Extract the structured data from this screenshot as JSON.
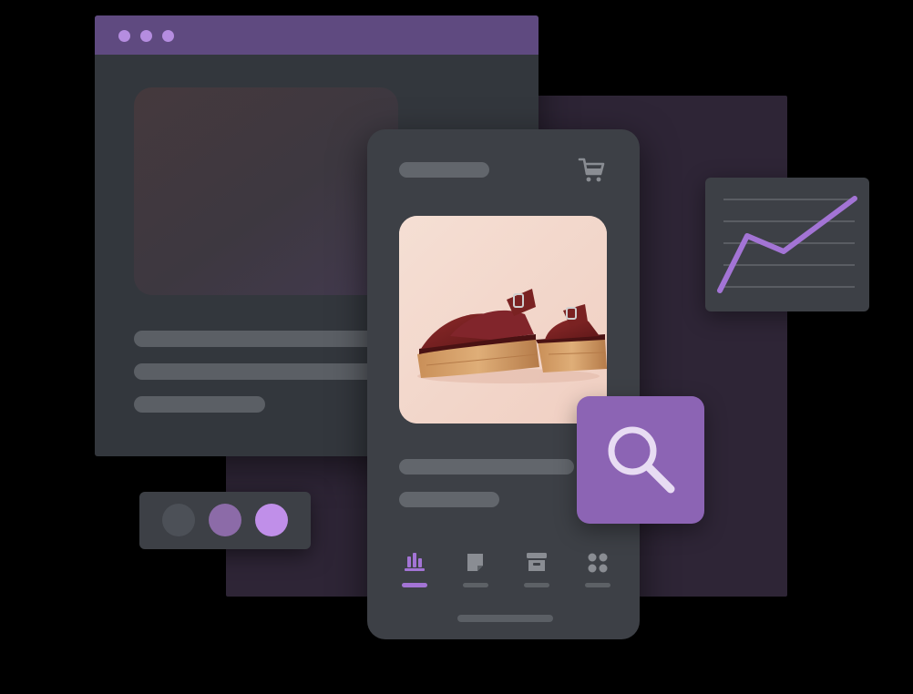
{
  "colors": {
    "browser_titlebar": "#5f4a80",
    "window_dots": "#b58de0",
    "accent": "#8c64b4",
    "chart_line": "#a374d5",
    "swatches": [
      "#4c5057",
      "#8c6ba8",
      "#c08fe9"
    ]
  },
  "browser": {
    "window_dots": 3,
    "text_lines": 3
  },
  "phone": {
    "header_icon": "shopping-cart-icon",
    "product_image": "burgundy-platform-sandals",
    "nav_items": [
      {
        "icon": "bar-chart-icon",
        "active": true
      },
      {
        "icon": "note-icon",
        "active": false
      },
      {
        "icon": "archive-box-icon",
        "active": false
      },
      {
        "icon": "grid-icon",
        "active": false
      }
    ]
  },
  "chart_card": {
    "icon": "trend-line-icon",
    "trend": "rising"
  },
  "search_button": {
    "icon": "search-icon"
  }
}
